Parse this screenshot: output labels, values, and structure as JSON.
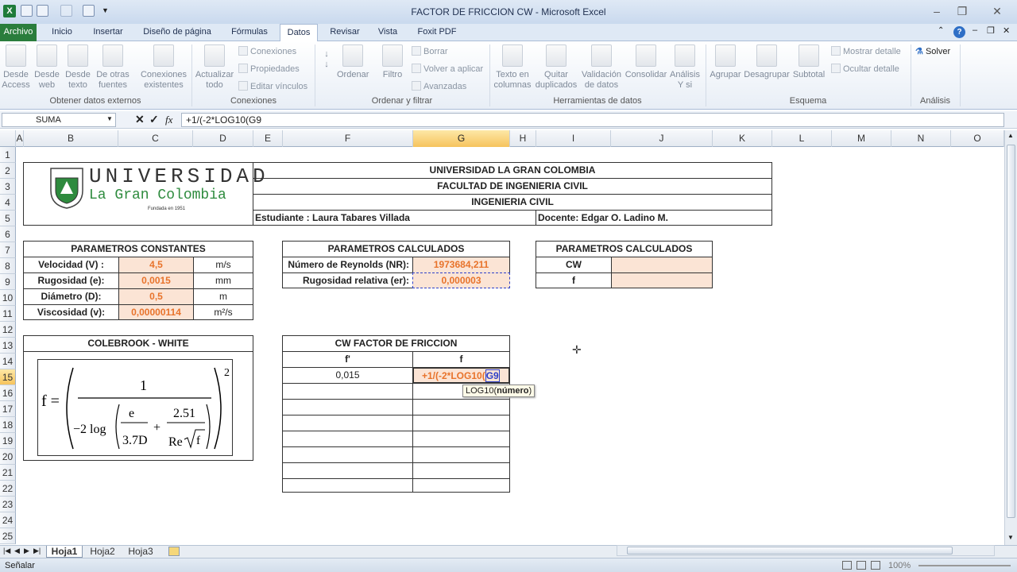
{
  "window": {
    "title": "FACTOR DE FRICCION CW - Microsoft Excel"
  },
  "tabs": [
    "Archivo",
    "Inicio",
    "Insertar",
    "Diseño de página",
    "Fórmulas",
    "Datos",
    "Revisar",
    "Vista",
    "Foxit PDF"
  ],
  "ribbon": {
    "desde_access": "Desde Access",
    "desde_web": "Desde web",
    "desde_texto": "Desde texto",
    "otras_fuentes": "De otras fuentes",
    "conexiones_existentes": "Conexiones existentes",
    "actualizar_todo": "Actualizar todo",
    "conexiones": "Conexiones",
    "propiedades": "Propiedades",
    "editar_vinculos": "Editar vínculos",
    "ordenar": "Ordenar",
    "filtro": "Filtro",
    "borrar": "Borrar",
    "volver_aplicar": "Volver a aplicar",
    "avanzadas": "Avanzadas",
    "texto_columnas": "Texto en columnas",
    "quitar_duplicados": "Quitar duplicados",
    "validacion": "Validación de datos",
    "consolidar": "Consolidar",
    "analisis_ysi": "Análisis Y si",
    "agrupar": "Agrupar",
    "desagrupar": "Desagrupar",
    "subtotal": "Subtotal",
    "mostrar_detalle": "Mostrar detalle",
    "ocultar_detalle": "Ocultar detalle",
    "solver": "Solver",
    "groups": {
      "externos": "Obtener datos externos",
      "conexiones": "Conexiones",
      "ordenar": "Ordenar y filtrar",
      "herramientas": "Herramientas de datos",
      "esquema": "Esquema",
      "analisis": "Análisis"
    }
  },
  "formula_bar": {
    "name_box": "SUMA",
    "formula": "+1/(-2*LOG10(G9",
    "fx": "fx"
  },
  "columns": [
    "A",
    "B",
    "C",
    "D",
    "E",
    "F",
    "G",
    "H",
    "I",
    "J",
    "K",
    "L",
    "M",
    "N",
    "O"
  ],
  "rows": [
    "1",
    "2",
    "3",
    "4",
    "5",
    "6",
    "7",
    "8",
    "9",
    "10",
    "11",
    "12",
    "13",
    "14",
    "15",
    "16",
    "17",
    "18",
    "19",
    "20",
    "21",
    "22",
    "23",
    "24",
    "25"
  ],
  "header": {
    "logo_line1": "UNIVERSIDAD",
    "logo_line2": "La Gran Colombia",
    "logo_line3": "Fundada en 1951",
    "university": "UNIVERSIDAD LA GRAN COLOMBIA",
    "faculty": "FACULTAD DE INGENIERIA CIVIL",
    "program": "INGENIERIA CIVIL",
    "student": "Estudiante : Laura Tabares Villada",
    "teacher": "Docente: Edgar O. Ladino M."
  },
  "constants": {
    "title": "PARAMETROS CONSTANTES",
    "rows": [
      {
        "label": "Velocidad (V) :",
        "value": "4,5",
        "unit": "m/s"
      },
      {
        "label": "Rugosidad (e):",
        "value": "0,0015",
        "unit": "mm"
      },
      {
        "label": "Diámetro (D):",
        "value": "0,5",
        "unit": "m"
      },
      {
        "label": "Viscosidad (v):",
        "value": "0,00000114",
        "unit": "m²/s"
      }
    ]
  },
  "calculated1": {
    "title": "PARAMETROS CALCULADOS",
    "rows": [
      {
        "label": "Número de Reynolds (NR):",
        "value": "1973684,211"
      },
      {
        "label": "Rugosidad relativa (er):",
        "value": "0,000003"
      }
    ]
  },
  "calculated2": {
    "title": "PARAMETROS CALCULADOS",
    "rows": [
      {
        "label": "CW",
        "value": ""
      },
      {
        "label": "f",
        "value": ""
      }
    ]
  },
  "colebrook": {
    "title": "COLEBROOK - WHITE"
  },
  "cw_table": {
    "title": "CW FACTOR DE FRICCION",
    "col1": "f'",
    "col2": "f",
    "f_prime": "0,015",
    "editing_prefix": "+1/(-2*LOG10(",
    "editing_ref": "G9"
  },
  "tooltip": {
    "fn": "LOG10(",
    "arg": "número",
    "close": ")"
  },
  "sheets": [
    "Hoja1",
    "Hoja2",
    "Hoja3"
  ],
  "status": {
    "mode": "Señalar",
    "zoom": "100%"
  }
}
